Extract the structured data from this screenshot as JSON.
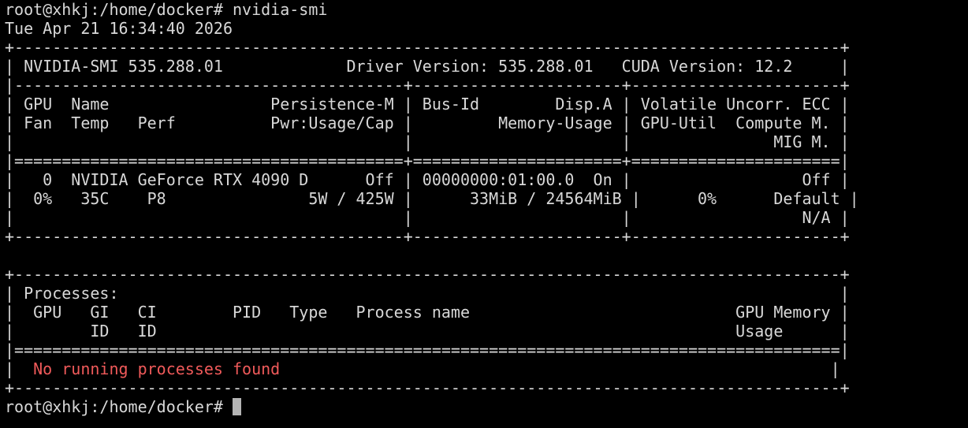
{
  "terminal": {
    "lines": [
      "root@xhkj:/home/docker# nvidia-smi",
      "Tue Apr 21 16:34:40 2026",
      "+---------------------------------------------------------------------------------------+",
      "| NVIDIA-SMI 535.288.01             Driver Version: 535.288.01   CUDA Version: 12.2     |",
      "|-----------------------------------------+----------------------+----------------------+",
      "| GPU  Name                 Persistence-M | Bus-Id        Disp.A | Volatile Uncorr. ECC |",
      "| Fan  Temp   Perf          Pwr:Usage/Cap |         Memory-Usage | GPU-Util  Compute M. |",
      "|                                         |                      |               MIG M. |",
      "|=========================================+======================+======================|",
      "|   0  NVIDIA GeForce RTX 4090 D      Off | 00000000:01:00.0  On |                  Off |",
      "|  0%   35C    P8               5W / 425W |      33MiB / 24564MiB |      0%      Default |",
      "|                                         |                      |                  N/A |",
      "+-----------------------------------------+----------------------+----------------------+",
      "",
      "+---------------------------------------------------------------------------------------+",
      "| Processes:                                                                            |",
      "|  GPU   GI   CI        PID   Type   Process name                            GPU Memory |",
      "|        ID   ID                                                             Usage      |",
      "|=======================================================================================|"
    ],
    "no_process_prefix": "|  ",
    "no_process_text": "No running processes found",
    "no_process_suffix": "                                                          |",
    "bottom_border": "+---------------------------------------------------------------------------------------+",
    "prompt": "root@xhkj:/home/docker# ",
    "error_color": "#f05a5a",
    "text_color": "#d8d8d8",
    "background_color": "#000000"
  }
}
